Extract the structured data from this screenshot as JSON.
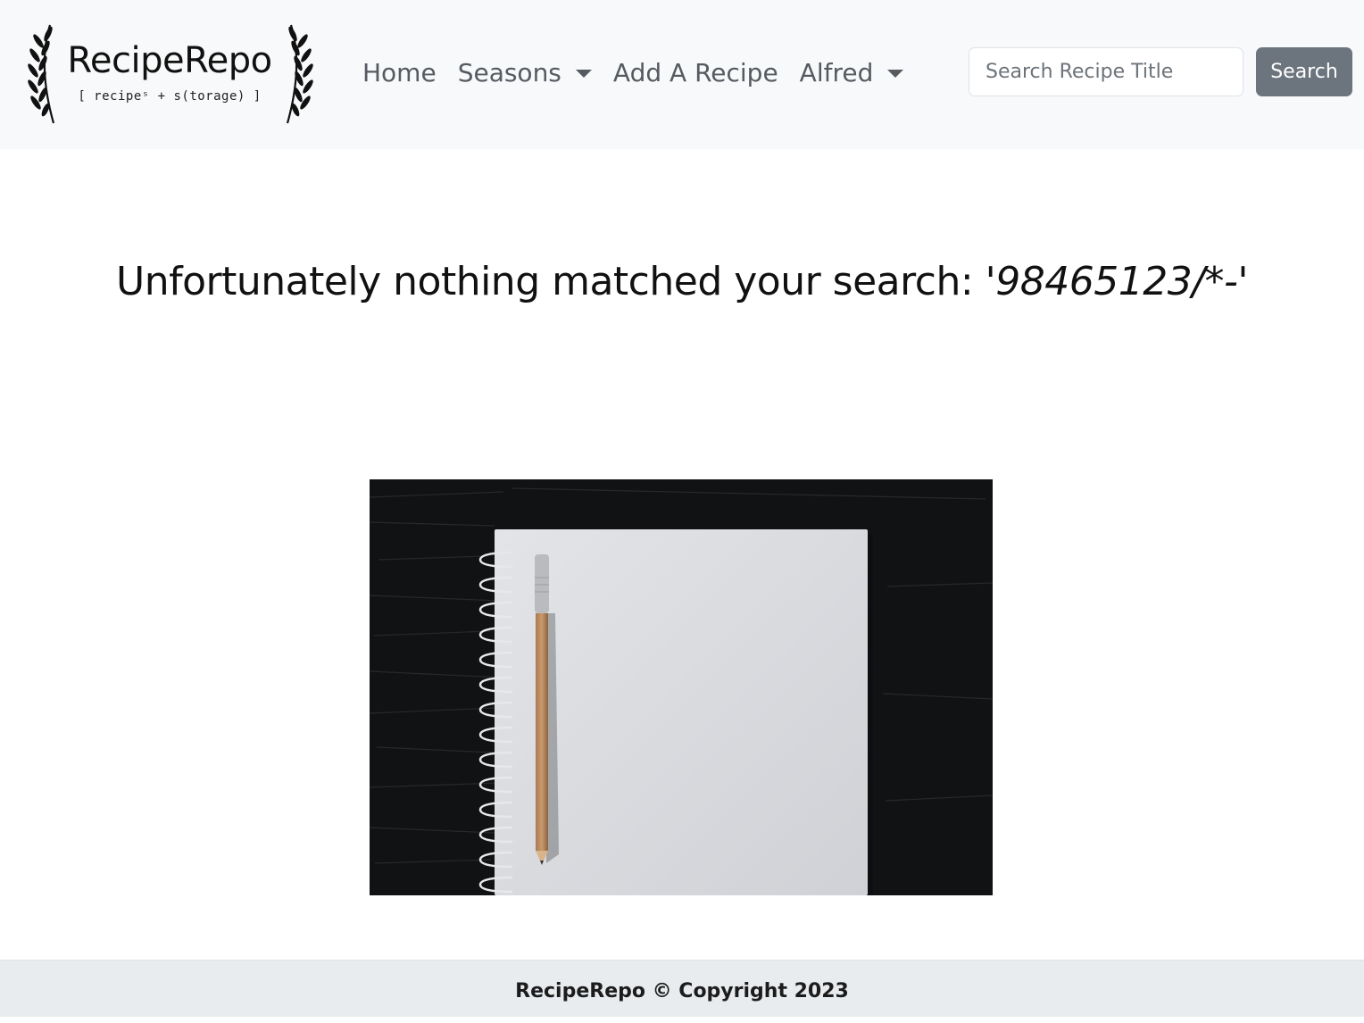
{
  "brand": {
    "name": "RecipeRepo",
    "tagline": "[ recipeˢ + s(torage) ]"
  },
  "nav": {
    "home": "Home",
    "seasons": "Seasons",
    "add_recipe": "Add A Recipe",
    "user": "Alfred"
  },
  "search": {
    "placeholder": "Search Recipe Title",
    "value": "",
    "button_label": "Search"
  },
  "message": {
    "prefix": "Unfortunately nothing matched your search: '",
    "query": "98465123/*-",
    "suffix": "'"
  },
  "footer": {
    "text": "RecipeRepo © Copyright 2023"
  },
  "colors": {
    "navbar_bg": "#f8f9fa",
    "nav_link": "#555b61",
    "search_button": "#6c757d",
    "footer_bg": "#e9ecef"
  },
  "icons": {
    "brand_left": "laurel-branch-icon",
    "brand_right": "laurel-branch-icon",
    "dropdown": "caret-down-icon"
  }
}
